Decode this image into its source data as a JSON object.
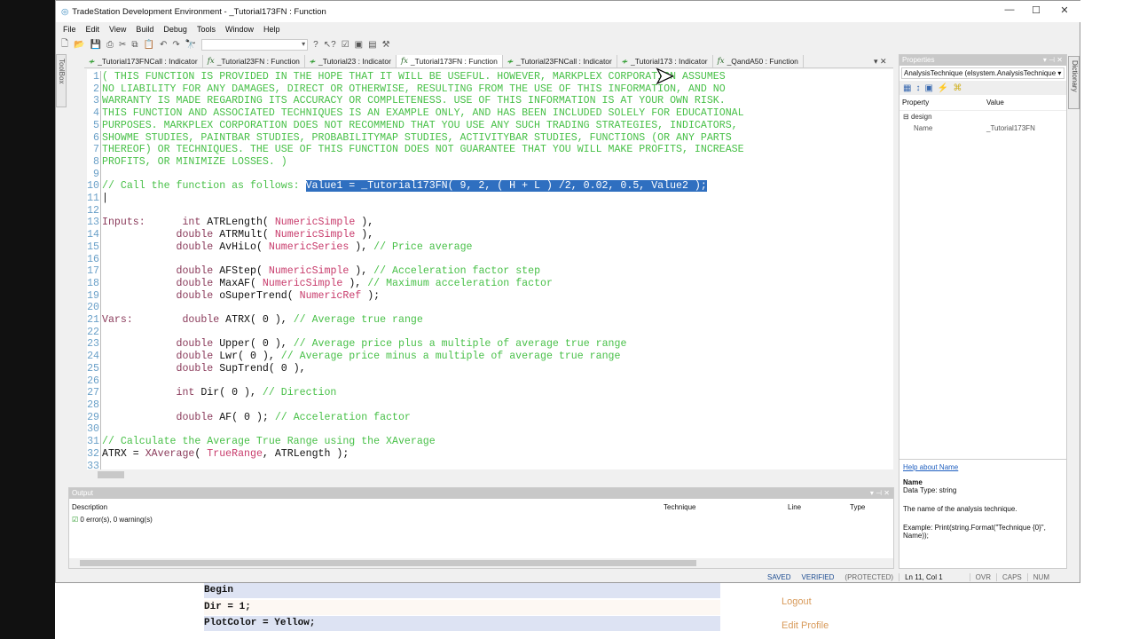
{
  "window": {
    "title": "TradeStation Development Environment - _Tutorial173FN : Function",
    "minimize": "—",
    "maximize": "☐",
    "close": "✕"
  },
  "menu": [
    "File",
    "Edit",
    "View",
    "Build",
    "Debug",
    "Tools",
    "Window",
    "Help"
  ],
  "toolbox_label": "ToolBox",
  "tabs": [
    {
      "label": "_Tutorial173FNCall : Indicator",
      "type": "indicator",
      "active": false
    },
    {
      "label": "_Tutorial23FN : Function",
      "type": "function",
      "active": false
    },
    {
      "label": "_Tutorial23 : Indicator",
      "type": "indicator",
      "active": false
    },
    {
      "label": "_Tutorial173FN : Function",
      "type": "function",
      "active": true
    },
    {
      "label": "_Tutorial23FNCall : Indicator",
      "type": "indicator",
      "active": false
    },
    {
      "label": "_Tutorial173 : Indicator",
      "type": "indicator",
      "active": false
    },
    {
      "label": "_QandA50 : Function",
      "type": "function",
      "active": false
    }
  ],
  "code": [
    [
      [
        "com",
        "( THIS FUNCTION IS PROVIDED IN THE HOPE THAT IT WILL BE USEFUL. HOWEVER, MARKPLEX CORPORATION ASSUMES"
      ]
    ],
    [
      [
        "com",
        "NO LIABILITY FOR ANY DAMAGES, DIRECT OR OTHERWISE, RESULTING FROM THE USE OF THIS INFORMATION, AND NO"
      ]
    ],
    [
      [
        "com",
        "WARRANTY IS MADE REGARDING ITS ACCURACY OR COMPLETENESS. USE OF THIS INFORMATION IS AT YOUR OWN RISK."
      ]
    ],
    [
      [
        "com",
        "THIS FUNCTION AND ASSOCIATED TECHNIQUES IS AN EXAMPLE ONLY, AND HAS BEEN INCLUDED SOLELY FOR EDUCATIONAL"
      ]
    ],
    [
      [
        "com",
        "PURPOSES. MARKPLEX CORPORATION DOES NOT RECOMMEND THAT YOU USE ANY SUCH TRADING STRATEGIES, INDICATORS,"
      ]
    ],
    [
      [
        "com",
        "SHOWME STUDIES, PAINTBAR STUDIES, PROBABILITYMAP STUDIES, ACTIVITYBAR STUDIES, FUNCTIONS (OR ANY PARTS"
      ]
    ],
    [
      [
        "com",
        "THEREOF) OR TECHNIQUES. THE USE OF THIS FUNCTION DOES NOT GUARANTEE THAT YOU WILL MAKE PROFITS, INCREASE"
      ]
    ],
    [
      [
        "com",
        "PROFITS, OR MINIMIZE LOSSES. )"
      ]
    ],
    [],
    [
      [
        "com",
        "// Call the function as follows: "
      ],
      [
        "sel",
        "Value1 = _Tutorial173FN( 9, 2, ( H + L ) /2, 0.02, 0.5, Value2 );"
      ]
    ],
    [],
    [],
    [
      [
        "kw",
        "Inputs:"
      ],
      [
        "pl",
        "      "
      ],
      [
        "kw",
        "int"
      ],
      [
        "pl",
        " ATRLength( "
      ],
      [
        "res",
        "NumericSimple"
      ],
      [
        "pl",
        " ),"
      ]
    ],
    [
      [
        "pl",
        "            "
      ],
      [
        "kw",
        "double"
      ],
      [
        "pl",
        " ATRMult( "
      ],
      [
        "res",
        "NumericSimple"
      ],
      [
        "pl",
        " ),"
      ]
    ],
    [
      [
        "pl",
        "            "
      ],
      [
        "kw",
        "double"
      ],
      [
        "pl",
        " AvHiLo( "
      ],
      [
        "res",
        "NumericSeries"
      ],
      [
        "pl",
        " ), "
      ],
      [
        "com",
        "// Price average"
      ]
    ],
    [],
    [
      [
        "pl",
        "            "
      ],
      [
        "kw",
        "double"
      ],
      [
        "pl",
        " AFStep( "
      ],
      [
        "res",
        "NumericSimple"
      ],
      [
        "pl",
        " ), "
      ],
      [
        "com",
        "// Acceleration factor step"
      ]
    ],
    [
      [
        "pl",
        "            "
      ],
      [
        "kw",
        "double"
      ],
      [
        "pl",
        " MaxAF( "
      ],
      [
        "res",
        "NumericSimple"
      ],
      [
        "pl",
        " ), "
      ],
      [
        "com",
        "// Maximum acceleration factor"
      ]
    ],
    [
      [
        "pl",
        "            "
      ],
      [
        "kw",
        "double"
      ],
      [
        "pl",
        " oSuperTrend( "
      ],
      [
        "res",
        "NumericRef"
      ],
      [
        "pl",
        " );"
      ]
    ],
    [],
    [
      [
        "kw",
        "Vars:"
      ],
      [
        "pl",
        "        "
      ],
      [
        "kw",
        "double"
      ],
      [
        "pl",
        " ATRX( 0 ), "
      ],
      [
        "com",
        "// Average true range"
      ]
    ],
    [],
    [
      [
        "pl",
        "            "
      ],
      [
        "kw",
        "double"
      ],
      [
        "pl",
        " Upper( 0 ), "
      ],
      [
        "com",
        "// Average price plus a multiple of average true range"
      ]
    ],
    [
      [
        "pl",
        "            "
      ],
      [
        "kw",
        "double"
      ],
      [
        "pl",
        " Lwr( 0 ), "
      ],
      [
        "com",
        "// Average price minus a multiple of average true range"
      ]
    ],
    [
      [
        "pl",
        "            "
      ],
      [
        "kw",
        "double"
      ],
      [
        "pl",
        " SupTrend( 0 ),"
      ]
    ],
    [],
    [
      [
        "pl",
        "            "
      ],
      [
        "kw",
        "int"
      ],
      [
        "pl",
        " Dir( 0 ), "
      ],
      [
        "com",
        "// Direction"
      ]
    ],
    [],
    [
      [
        "pl",
        "            "
      ],
      [
        "kw",
        "double"
      ],
      [
        "pl",
        " AF( 0 ); "
      ],
      [
        "com",
        "// Acceleration factor"
      ]
    ],
    [],
    [
      [
        "com",
        "// Calculate the Average True Range using the XAverage"
      ]
    ],
    [
      [
        "pl",
        "ATRX = "
      ],
      [
        "kw",
        "XAverage"
      ],
      [
        "pl",
        "( "
      ],
      [
        "res",
        "TrueRange"
      ],
      [
        "pl",
        ", ATRLength );"
      ]
    ],
    []
  ],
  "output": {
    "title": "Output",
    "columns": [
      "Description",
      "Technique",
      "Line",
      "Type"
    ],
    "message": "0 error(s), 0 warning(s)"
  },
  "properties": {
    "title": "Properties",
    "object": "AnalysisTechnique (elsystem.AnalysisTechnique",
    "col_property": "Property",
    "col_value": "Value",
    "group": "design",
    "rows": [
      {
        "name": "Name",
        "value": "_Tutorial173FN"
      }
    ],
    "help_link": "Help about Name",
    "help_title": "Name",
    "help_type": "Data Type: string",
    "help_desc": "The name of the analysis technique.",
    "help_example": "Example: Print(string.Format(\"Technique {0}\", Name));"
  },
  "dictionary_label": "Dictionary",
  "status": [
    "SAVED",
    "VERIFIED",
    "(PROTECTED)",
    "Ln 11, Col 1",
    "OVR",
    "CAPS",
    "NUM"
  ],
  "web": {
    "rows": [
      "Begin",
      "Dir = 1;",
      "PlotColor = Yellow;"
    ],
    "links": [
      "Logout",
      "Edit Profile"
    ]
  }
}
